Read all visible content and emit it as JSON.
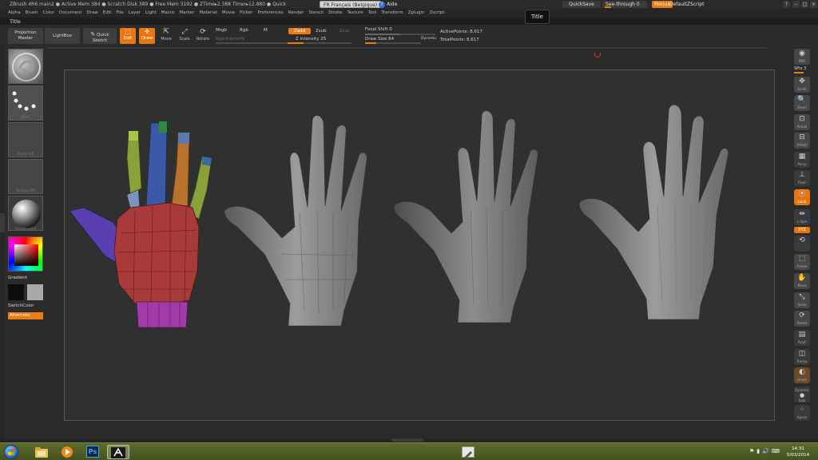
{
  "titlebar": {
    "status": "ZBrush 4R6    main2    ● Active Mem 384 ● Scratch Disk 389 ● Free Mem 3192 ● ZTime▸2.388  Timer▸12.880 ● Quick",
    "language": "FR Français (Belgique)",
    "help": "Aide",
    "quicksave": "QuickSave",
    "see_through": "See-through  0",
    "menus": "Menus",
    "default_zscript": "DefaultZScript"
  },
  "menubar": [
    "Alpha",
    "Brush",
    "Color",
    "Document",
    "Draw",
    "Edit",
    "File",
    "Layer",
    "Light",
    "Macro",
    "Marker",
    "Material",
    "Movie",
    "Picker",
    "Preferences",
    "Render",
    "Stencil",
    "Stroke",
    "Texture",
    "Tool",
    "Transform",
    "Zplugin",
    "Zscript"
  ],
  "tooltip": "Title",
  "shelf": {
    "title": "Title",
    "projection_master": "Projection Master",
    "lightbox": "LightBox",
    "quick_sketch": "Quick Sketch",
    "edit": "Edit",
    "draw": "Draw",
    "move": "Move",
    "scale": "Scale",
    "rotate": "Rotate",
    "mrgb": "Mrgb",
    "rgb": "Rgb",
    "m": "M",
    "rgb_intensity": "Rgb  Intensity",
    "zadd": "Zadd",
    "zsub": "Zsub",
    "zcut": "Zcut",
    "z_intensity": "Z Intensity 25",
    "focal_shift": "Focal Shift 0",
    "draw_size": "Draw Size 64",
    "dynamic": "Dynamic",
    "active_points": "ActivePoints: 8,617",
    "total_points": "TotalPoints: 8,617"
  },
  "left_tray": {
    "brush_label": "Standard",
    "stroke_label": "Dots",
    "alpha_label": "Alpha Off",
    "texture_label": "Texture Off",
    "material_label": "SkinShade4",
    "gradient": "Gradient",
    "switch_color": "SwitchColor",
    "alternate": "Alternate",
    "main_color": "#0c0c0c",
    "secondary_color": "#a9a9a9"
  },
  "right_tray": {
    "bpr": "BPR",
    "spix": "SPix 3",
    "scroll": "Scroll",
    "zoom": "Zoom",
    "actual": "Actual",
    "aahalf": "AAHalf",
    "persp": "Persp",
    "floor": "Floor",
    "local": "Local",
    "lsym": "L.Sym",
    "xyz": "XYZ",
    "frame": "Frame",
    "move": "Move",
    "scale": "Scale",
    "rotate": "Rotate",
    "polyf": "PolyF",
    "transp": "Transp",
    "ghost": "Ghost",
    "dynamic": "Dynamic",
    "solo": "Solo",
    "xpose": "Xpose"
  },
  "taskbar": {
    "time": "14:31",
    "date": "5/03/2014",
    "ps_label": "Ps"
  },
  "colors": {
    "accent": "#e97c13",
    "hand_palm": "#a83a3a",
    "hand_thumb": "#5a3fb0",
    "hand_wrist": "#a23aa8",
    "finger_green": "#8aa13a",
    "finger_blue": "#3a5aa8",
    "finger_orange": "#b8722d"
  }
}
